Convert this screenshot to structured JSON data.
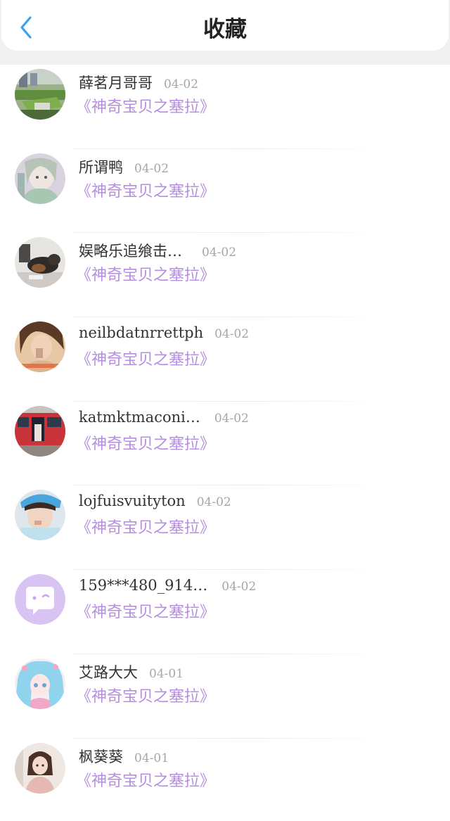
{
  "header": {
    "title": "收藏",
    "back_icon": "chevron-left-icon",
    "accent": "#3aa0f0"
  },
  "colors": {
    "book_link": "#b58ee0",
    "date": "#a6a6a6",
    "name": "#333333"
  },
  "items": [
    {
      "name": "薛茗月哥哥",
      "date": "04-02",
      "book": "《神奇宝贝之塞拉》",
      "avatar": "photo-avatar-garden"
    },
    {
      "name": "所谓鸭",
      "date": "04-02",
      "book": "《神奇宝贝之塞拉》",
      "avatar": "anime-avatar-pastel"
    },
    {
      "name": "娱略乐追飨击…",
      "date": "04-02",
      "book": "《神奇宝贝之塞拉》",
      "avatar": "photo-avatar-dog"
    },
    {
      "name": "neilbdatnrrettph",
      "date": "04-02",
      "book": "《神奇宝贝之塞拉》",
      "avatar": "photo-avatar-portrait"
    },
    {
      "name": "katmktmaconi…",
      "date": "04-02",
      "book": "《神奇宝贝之塞拉》",
      "avatar": "photo-avatar-train"
    },
    {
      "name": "lojfuisvuityton",
      "date": "04-02",
      "book": "《神奇宝贝之塞拉》",
      "avatar": "photo-avatar-boy"
    },
    {
      "name": "159***480_914…",
      "date": "04-02",
      "book": "《神奇宝贝之塞拉》",
      "avatar": "default-chat-avatar"
    },
    {
      "name": "艾路大大",
      "date": "04-01",
      "book": "《神奇宝贝之塞拉》",
      "avatar": "anime-avatar-blue-hair"
    },
    {
      "name": "枫葵葵",
      "date": "04-01",
      "book": "《神奇宝贝之塞拉》",
      "avatar": "anime-avatar-girl"
    }
  ]
}
